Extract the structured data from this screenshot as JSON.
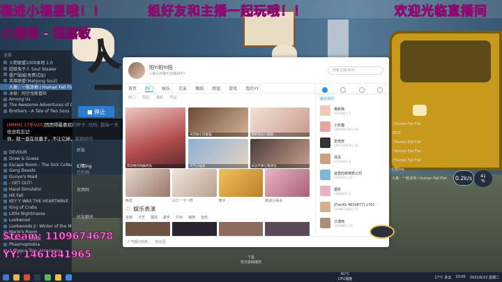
{
  "overlay": {
    "danmu": [
      "福进小福星哦！！",
      "姐好友和主播一起玩哦！！",
      "欢迎光临直播间"
    ],
    "streamer_name": "小猎兽 - 程嘉敏",
    "big_chars": [
      "人",
      "一"
    ],
    "steam_id": "Steam: 1109674678",
    "yy_id": "YY: 1461841965"
  },
  "steam_sidebar": {
    "section_all": "全部",
    "games_top": [
      "火箭联盟1000本地 1.0",
      "超级兔子人 Soul Stealer",
      "僵尸围城(免费试玩)",
      "英雄联盟(Mahjong Soul)",
      "人类：一败涂地 / Human Fall Flat",
      "冰球：阿尔戈斯冒险",
      "Among Us",
      "The Awesome Adventures of Captain",
      "Brothers - A Tale of Two Sons"
    ],
    "games_bottom": [
      "DEVOUR",
      "Draw & Guess",
      "Escape Room - The Sick Colleague",
      "Gang Beasts",
      "Gunyo's Maid",
      "- GET OUT!",
      "Hand Simulator",
      "Hit Fall",
      "KEY Y WAS THE HEARTWAVE",
      "King of Crabs",
      "Little Nightmares",
      "Lookwood",
      "Lookwoods Jr: Winter of the Melodies",
      "Marie's Room",
      "Pewsbox 速度酷",
      "Phasmophobia",
      "A Plague Tale: Innocence"
    ],
    "selected_index": 4
  },
  "stop_button": "■ 停止",
  "chat_popup": {
    "prefix": "[MMM]",
    "highlight": " 17乐V25]",
    "text1": "团团得最喜欢的杯子: 玛玛, 我每一天也没有忘记",
    "text2": "你，就一直在坟墓子，不让它掉，我很好的"
  },
  "mid_panel": {
    "label1": "好友",
    "user": "幻情ing",
    "user_status": "已在线",
    "hint1": "东西吗",
    "hint2": "好友聊天"
  },
  "app": {
    "title": "阳YI阳YI阳",
    "subtitle": "<最火的娱乐直播APP>",
    "search_placeholder": "搜索主播/房间",
    "tabs": [
      "首页",
      "热门",
      "娱乐",
      "交友",
      "舞蹈",
      "颜值",
      "游戏",
      "我的YY"
    ],
    "active_tab": 1,
    "subtabs": [
      "热门",
      "周边",
      "最新",
      "附近"
    ],
    "feature_label": "风华绝代纯妹时光",
    "cards_top": [
      "天空娇小可爱猫",
      "我的快乐小姐姐",
      "元气小仙女",
      "永远不要让我哭泣"
    ],
    "cards_bottom_labels": [
      "新店",
      "三仁一十一样",
      "笨子",
      "新进小仙女"
    ],
    "section_title": "娱乐表演",
    "section_tabs": [
      "全部",
      "才艺",
      "国风",
      "歌手",
      "户外",
      "萌宠",
      "音乐"
    ],
    "footer_user": "人气都比较高...",
    "footer_hint": "粉丝团"
  },
  "app_side": {
    "head": "最近访问",
    "contacts": [
      {
        "name": "奥斯特",
        "meta": "1475000 | 5"
      },
      {
        "name": "小奶猫",
        "meta": "1495000750 | 30"
      },
      {
        "name": "雷竞技",
        "meta": "1467140930 | 30"
      },
      {
        "name": "清清",
        "meta": "1475400 | 6"
      },
      {
        "name": "运营的菲律宾公司",
        "meta": "1456907 | 15"
      },
      {
        "name": "烟花",
        "meta": "1466640 | 2"
      },
      {
        "name": "[Fox/Kk 4659877] 1701",
        "meta": "1458811500 | 16"
      },
      {
        "name": "沙漠雨",
        "meta": "1456981 | 14"
      }
    ]
  },
  "right_chat": [
    "/ Human Fall Flat",
    "7815",
    "/ Human Fall Flat",
    "/ Human Fall Flat",
    "/ Human Fall Flat",
    "幻影ing",
    "人类：一败涂地 / Human Fall Flat"
  ],
  "badges": {
    "percent": "41",
    "percent_unit": "%",
    "net": "0.2k/s"
  },
  "next_song": {
    "label": "下首",
    "name": "暂无歌曲播放"
  },
  "taskbar": {
    "cpu_temp": "61°C",
    "cpu_label": "CPU温度",
    "weather": "17°C 多云",
    "time": "23:05",
    "date": "2021/6/22 星期二"
  }
}
